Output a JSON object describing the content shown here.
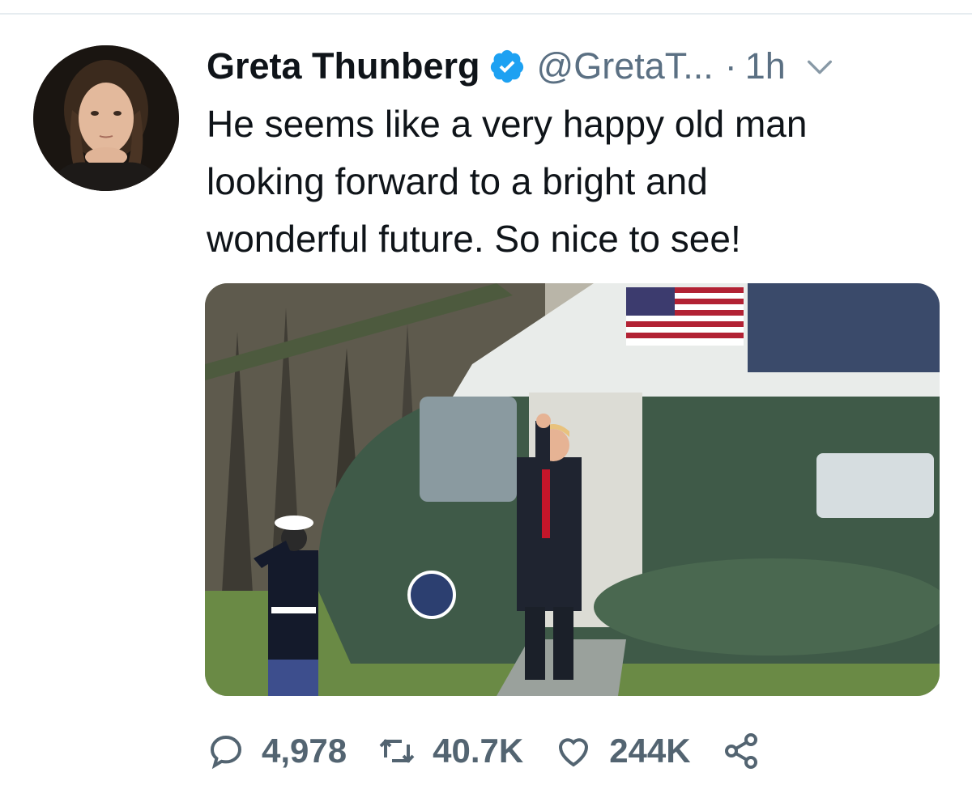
{
  "author": {
    "display_name": "Greta Thunberg",
    "handle": "@GretaT...",
    "separator": "·",
    "time": "1h",
    "verified": true
  },
  "tweet": {
    "text": "He seems like a very happy old man\nlooking forward to a bright and\nwonderful future. So nice to see!"
  },
  "media": {
    "icon": "photo"
  },
  "actions": {
    "replies": "4,978",
    "retweets": "40.7K",
    "likes": "244K"
  },
  "icons": {
    "reply": "speech-bubble-icon",
    "retweet": "retweet-icon",
    "like": "heart-icon",
    "share": "share-icon",
    "verified": "verified-badge-icon",
    "menu": "chevron-down-icon"
  },
  "colors": {
    "verified_blue": "#1da1f2",
    "secondary_text": "#5b7083",
    "primary_text": "#0f1419"
  }
}
